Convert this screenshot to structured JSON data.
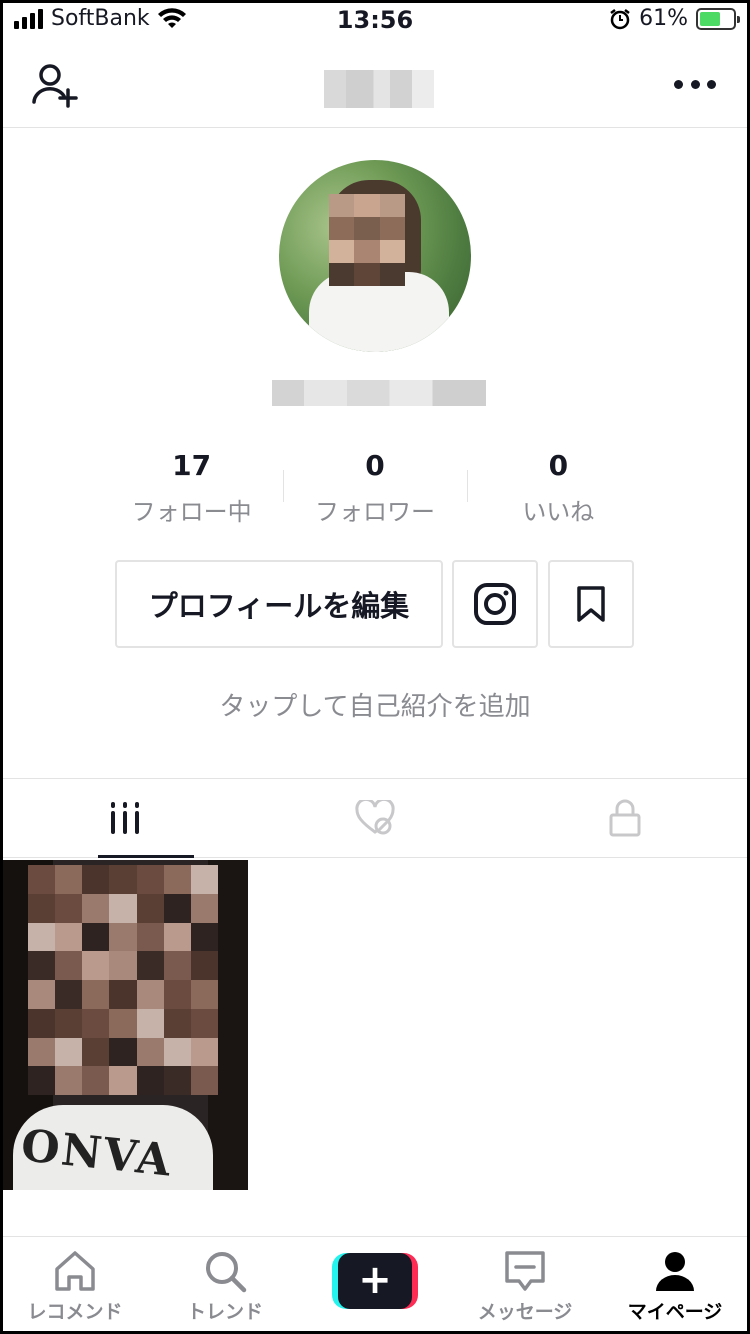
{
  "status_bar": {
    "carrier": "SoftBank",
    "time": "13:56",
    "battery_percent": "61%",
    "battery_level": 0.61
  },
  "nav": {
    "add_user_icon": "person-add-icon",
    "more_icon": "ellipsis-icon"
  },
  "profile": {
    "stats": [
      {
        "value": "17",
        "label": "フォロー中"
      },
      {
        "value": "0",
        "label": "フォロワー"
      },
      {
        "value": "0",
        "label": "いいね"
      }
    ],
    "edit_button": "プロフィールを編集",
    "bio_placeholder": "タップして自己紹介を追加"
  },
  "tabs": [
    {
      "icon": "grid-icon",
      "active": true
    },
    {
      "icon": "liked-hidden-icon",
      "active": false
    },
    {
      "icon": "lock-icon",
      "active": false
    }
  ],
  "video_thumbnail": {
    "shirt_text": "ONVA"
  },
  "bottom_nav": [
    {
      "label": "レコメンド",
      "icon": "home-icon"
    },
    {
      "label": "トレンド",
      "icon": "search-icon"
    },
    {
      "label": "",
      "icon": "plus-icon"
    },
    {
      "label": "メッセージ",
      "icon": "message-icon"
    },
    {
      "label": "マイページ",
      "icon": "profile-icon",
      "active": true
    }
  ],
  "colors": {
    "text_primary": "#161823",
    "text_secondary": "#8a8b91",
    "divider": "#e3e3e4",
    "accent_cyan": "#25f4ee",
    "accent_pink": "#fe2c55"
  }
}
